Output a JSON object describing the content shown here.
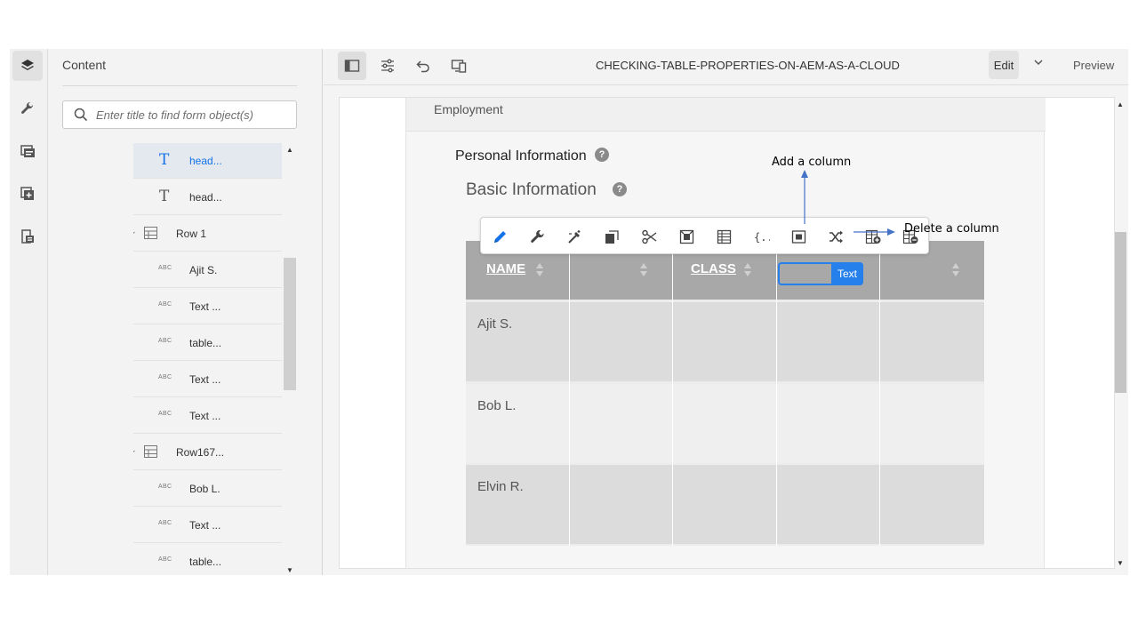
{
  "rail": {
    "icons": [
      "layers-icon",
      "wrench-icon",
      "form-template-icon",
      "add-component-icon",
      "data-source-icon"
    ]
  },
  "panel": {
    "title": "Content",
    "search_placeholder": "Enter title to find form object(s)",
    "tree": [
      {
        "label": "head...",
        "kind": "text",
        "selected": true
      },
      {
        "label": "head...",
        "kind": "text"
      },
      {
        "label": "Row 1",
        "kind": "row",
        "expanded": true
      },
      {
        "label": "Ajit S.",
        "kind": "abc"
      },
      {
        "label": "Text ...",
        "kind": "abc"
      },
      {
        "label": "table...",
        "kind": "abc"
      },
      {
        "label": "Text ...",
        "kind": "abc"
      },
      {
        "label": "Text ...",
        "kind": "abc"
      },
      {
        "label": "Row167...",
        "kind": "row",
        "expanded": true
      },
      {
        "label": "Bob L.",
        "kind": "abc"
      },
      {
        "label": "Text ...",
        "kind": "abc"
      },
      {
        "label": "table...",
        "kind": "abc"
      }
    ],
    "abc_icon_text": "ABC"
  },
  "topbar": {
    "title": "CHECKING-TABLE-PROPERTIES-ON-AEM-AS-A-CLOUD",
    "edit_label": "Edit",
    "preview_label": "Preview"
  },
  "form": {
    "section_label": "Employment",
    "panel_title": "Personal Information",
    "subtitle": "Basic Information",
    "help_glyph": "?",
    "table": {
      "headers": [
        "NAME",
        "",
        "CLASS",
        "",
        ""
      ],
      "rows": [
        [
          "Ajit S.",
          "",
          "",
          "",
          ""
        ],
        [
          "Bob L.",
          "",
          "",
          "",
          ""
        ],
        [
          "Elvin R.",
          "",
          "",
          "",
          ""
        ]
      ],
      "selected_cell_badge": "Text"
    }
  },
  "component_toolbar": {
    "icons": [
      "edit-icon",
      "configure-icon",
      "style-icon",
      "copy-icon",
      "cut-icon",
      "select-parent-icon",
      "table-icon",
      "rules-icon",
      "replace-icon",
      "shuffle-icon",
      "add-column-icon",
      "delete-column-icon"
    ]
  },
  "annotations": {
    "add_column": "Add a column",
    "delete_column": "Delete a column"
  },
  "colors": {
    "accent": "#2680eb",
    "header_bg": "#a8a8a8"
  }
}
